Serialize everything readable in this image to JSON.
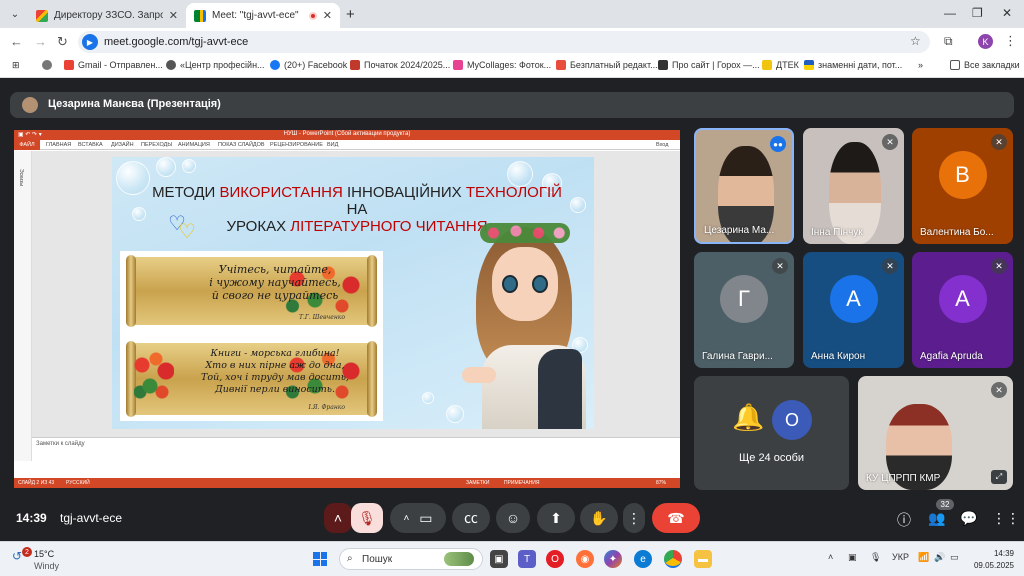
{
  "browser": {
    "tabs": [
      {
        "title": "Директору ЗЗСО. Запрошення",
        "icon": "gmail-icon"
      },
      {
        "title": "Meet: \"tgj-avvt-ece\"",
        "icon": "meet-icon",
        "active": true
      }
    ],
    "url": "meet.google.com/tgj-avvt-ece",
    "profile_initial": "K",
    "bookmarks": [
      "Gmail - Отправлен...",
      "«Центр професійн...",
      "(20+) Facebook",
      "Початок 2024/2025...",
      "MyCollages: Фоток...",
      "Безплатный редакт...",
      "Про сайт | Горох —...",
      "ДТЕК",
      "знаменні дати, пот...",
      "Все закладки"
    ]
  },
  "meet": {
    "presenter_label": "Цезарина Манєва (Презентація)",
    "time": "14:39",
    "code": "tgj-avvt-ece",
    "participants_count": "32",
    "tiles": [
      {
        "name": "Цезарина Ма...",
        "type": "camera",
        "speaking": true
      },
      {
        "name": "Інна Пінчук",
        "type": "camera",
        "muted": true
      },
      {
        "name": "Валентина Бо...",
        "letter": "В",
        "color": "#e8710a",
        "bg": "#a04000",
        "muted": true
      },
      {
        "name": "Галина Гаври...",
        "letter": "Г",
        "color": "#80868b",
        "bg": "#4d5f66",
        "muted": true
      },
      {
        "name": "Анна Кирон",
        "letter": "А",
        "color": "#1a73e8",
        "bg": "#164e82",
        "muted": true
      },
      {
        "name": "Agafia Apruda",
        "letter": "A",
        "color": "#8430ce",
        "bg": "#5c1e8e",
        "muted": true
      },
      {
        "name": "Ще 24 особи",
        "letter": "О",
        "color": "#3c5bb8",
        "bg": "#3c4043"
      },
      {
        "name": "КУ ЦПРПП КМР",
        "type": "camera",
        "muted": true
      }
    ]
  },
  "ppt": {
    "window_title": "НУШ - PowerPoint (Сбой активации продукта)",
    "ribbon_tabs": [
      "ФАЙЛ",
      "ГЛАВНАЯ",
      "ВСТАВКА",
      "ДИЗАЙН",
      "ПЕРЕХОДЫ",
      "АНИМАЦИЯ",
      "ПОКАЗ СЛАЙДОВ",
      "РЕЦЕНЗИРОВАНИЕ",
      "ВИД"
    ],
    "user_label": "Вход",
    "thumb_label": "Эскизы",
    "notes_placeholder": "Заметки к слайду",
    "status_left": "СЛАЙД 2 ИЗ 43",
    "status_lang": "РУССКИЙ",
    "status_notes": "ЗАМЕТКИ",
    "status_comments": "ПРИМЕЧАНИЯ",
    "zoom": "87%",
    "slide": {
      "title_line1_a": "МЕТОДИ ",
      "title_line1_b": "ВИКОРИСТАННЯ ",
      "title_line1_c": "ІННОВАЦІЙНИХ ",
      "title_line1_d": "ТЕХНОЛОГІЙ ",
      "title_line1_e": "НА",
      "title_line2_a": "УРОКАХ ",
      "title_line2_b": "ЛІТЕРАТУРНОГО ",
      "title_line2_c": "ЧИТАННЯ",
      "verse1": "Учітесь, читайте,\nі чужому научайтесь,\nй свого не цурайтесь",
      "verse1_author": "Т.Г. Шевченко",
      "verse2": "Книги - морська глибина!\nХто в них пірне аж до дна,\nТой, хоч і труду мав досить,\nДивнії перли виносить.",
      "verse2_author": "І.Я. Франко"
    }
  },
  "taskbar": {
    "weather_badge": "2",
    "temp": "15°C",
    "weather": "Windy",
    "search": "Пошук",
    "lang": "УКР",
    "time": "14:39",
    "date": "09.05.2025"
  }
}
